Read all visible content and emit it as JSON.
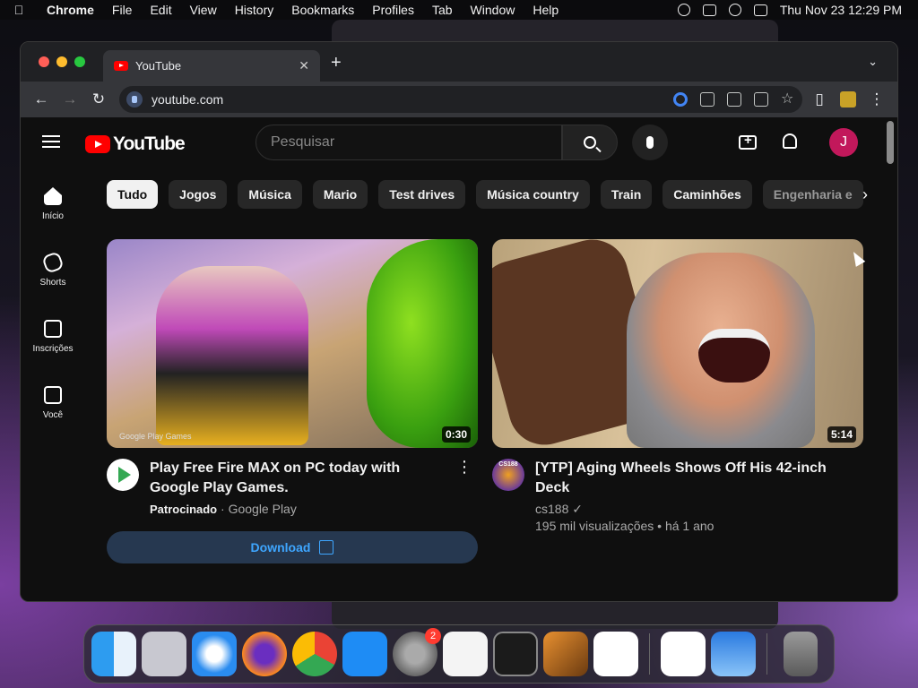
{
  "menubar": {
    "app": "Chrome",
    "items": [
      "File",
      "Edit",
      "View",
      "History",
      "Bookmarks",
      "Profiles",
      "Tab",
      "Window",
      "Help"
    ],
    "clock": "Thu Nov 23  12:29 PM"
  },
  "browser": {
    "tab_title": "YouTube",
    "url": "youtube.com"
  },
  "youtube": {
    "logo": "YouTube",
    "search_placeholder": "Pesquisar",
    "avatar_letter": "J",
    "sidebar": [
      {
        "label": "Início",
        "icon": "home-icon"
      },
      {
        "label": "Shorts",
        "icon": "shorts-icon"
      },
      {
        "label": "Inscrições",
        "icon": "subscriptions-icon"
      },
      {
        "label": "Você",
        "icon": "you-icon"
      }
    ],
    "chips": [
      "Tudo",
      "Jogos",
      "Música",
      "Mario",
      "Test drives",
      "Música country",
      "Train",
      "Caminhões",
      "Engenharia e"
    ],
    "videos": [
      {
        "title": "Play Free Fire MAX on PC today with Google Play Games.",
        "sponsored": "Patrocinado",
        "channel": "Google Play",
        "duration": "0:30",
        "watermark": "Google Play Games",
        "cta": "Download"
      },
      {
        "title": "[YTP] Aging Wheels Shows Off His 42-inch Deck",
        "channel": "cs188",
        "verified": "✓",
        "stats": "195 mil visualizações • há 1 ano",
        "duration": "5:14",
        "avatar_text": "CS188"
      }
    ]
  },
  "dock": {
    "badge": "2",
    "apps": [
      "finder-icon",
      "launchpad-icon",
      "safari-icon",
      "firefox-icon",
      "chrome-icon",
      "app-store-icon",
      "system-settings-icon",
      "textedit-icon",
      "terminal-icon",
      "garageband-icon",
      "vscode-icon",
      "visual-studio-icon",
      "weather-icon",
      "trash-icon"
    ]
  },
  "colors": {
    "youtube_red": "#ff0000",
    "avatar": "#c2185b",
    "link_blue": "#3ea6ff"
  }
}
